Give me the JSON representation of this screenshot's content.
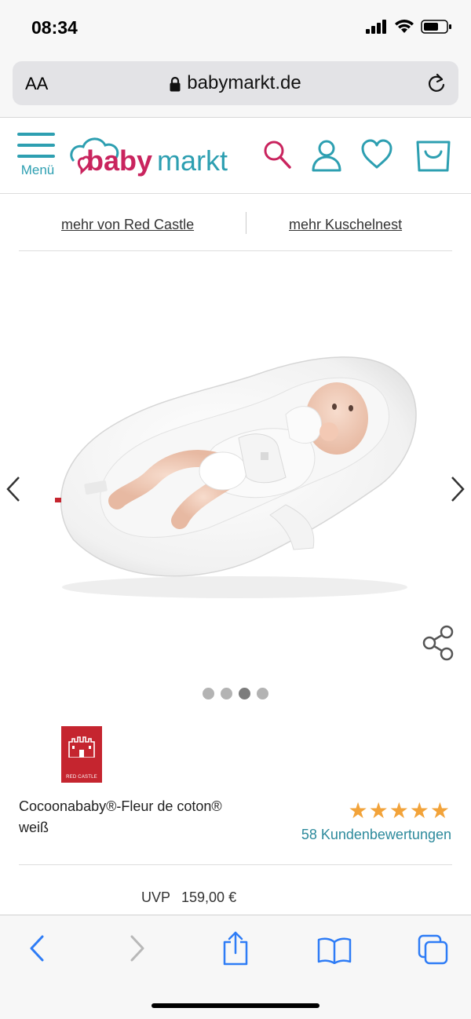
{
  "status_bar": {
    "time": "08:34"
  },
  "browser": {
    "text_size_label": "AA",
    "url": "babymarkt.de"
  },
  "header": {
    "menu_label": "Menü",
    "logo_text_1": "baby",
    "logo_text_2": "markt"
  },
  "links": [
    {
      "label": "mehr von Red Castle"
    },
    {
      "label": "mehr Kuschelnest"
    }
  ],
  "gallery": {
    "image_alt": "Cocoonababy nest with baby",
    "dots_count": 4,
    "active_dot": 2
  },
  "product": {
    "brand": "RED CASTLE",
    "name": "Cocoonababy®-Fleur de coton® weiß",
    "rating_stars": "★★★★★",
    "rating_value": 5,
    "reviews": "58 Kundenbewertungen",
    "uvp_label": "UVP",
    "uvp_price": "159,00 €"
  },
  "colors": {
    "brand_teal": "#2d9fb1",
    "brand_pink": "#c9245e",
    "star": "#f2a33a",
    "brand_red": "#c5252f"
  }
}
